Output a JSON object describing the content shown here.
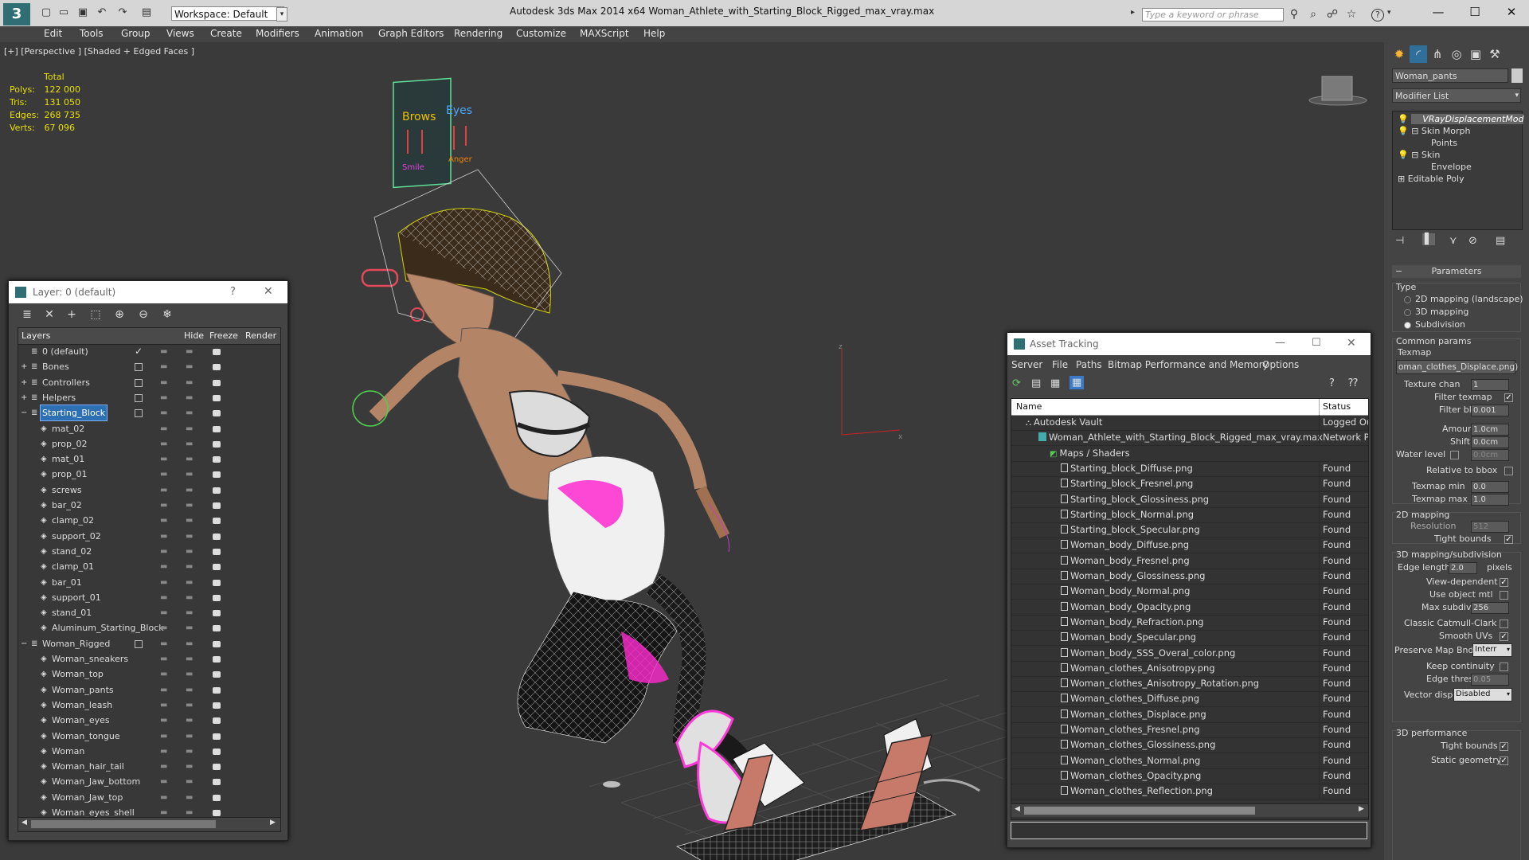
{
  "app": {
    "title": "Autodesk 3ds Max  2014 x64     Woman_Athlete_with_Starting_Block_Rigged_max_vray.max",
    "workspace": "Workspace: Default",
    "search_placeholder": "Type a keyword or phrase",
    "logo_glyph": "3"
  },
  "menu": [
    "Edit",
    "Tools",
    "Group",
    "Views",
    "Create",
    "Modifiers",
    "Animation",
    "Graph Editors",
    "Rendering",
    "Customize",
    "MAXScript",
    "Help"
  ],
  "viewport": {
    "label": "[+] [Perspective ] [Shaded + Edged Faces ]",
    "stats": {
      "header": "Total",
      "rows": [
        {
          "k": "Polys:",
          "v": "122 000"
        },
        {
          "k": "Tris:",
          "v": "131 050"
        },
        {
          "k": "Edges:",
          "v": "268 735"
        },
        {
          "k": "Verts:",
          "v": "67 096"
        }
      ]
    },
    "face_panel": {
      "brows": "Brows",
      "eyes": "Eyes",
      "smile": "Smile",
      "anger": "Anger"
    },
    "axis_z": "z",
    "axis_x": "x"
  },
  "command_panel": {
    "object_name": "Woman_pants",
    "modifier_list": "Modifier List",
    "stack": [
      {
        "label": "VRayDisplacementMod",
        "italic": true,
        "indent": 1
      },
      {
        "label": "Skin Morph",
        "indent": 1
      },
      {
        "label": "Points",
        "indent": 3
      },
      {
        "label": "Skin",
        "indent": 1
      },
      {
        "label": "Envelope",
        "indent": 3
      },
      {
        "label": "Editable Poly",
        "indent": 0
      }
    ],
    "params_title": "Parameters",
    "type_label": "Type",
    "type_options": [
      {
        "label": "2D mapping (landscape)",
        "on": false
      },
      {
        "label": "3D mapping",
        "on": false
      },
      {
        "label": "Subdivision",
        "on": true
      }
    ],
    "common_label": "Common params",
    "texmap_label": "Texmap",
    "texmap_value": "oman_clothes_Displace.png)",
    "texture_chan_label": "Texture chan",
    "texture_chan": "1",
    "filter_texmap_label": "Filter texmap",
    "filter_blur_label": "Filter blur",
    "filter_blur": "0.001",
    "amount_label": "Amount",
    "amount": "1.0cm",
    "shift_label": "Shift",
    "shift": "0.0cm",
    "water_level_label": "Water level",
    "water_level": "0.0cm",
    "relative_bbox_label": "Relative to bbox",
    "texmap_min_label": "Texmap min",
    "texmap_min": "0.0",
    "texmap_max_label": "Texmap max",
    "texmap_max": "1.0",
    "mapping2d_label": "2D mapping",
    "resolution_label": "Resolution",
    "resolution": "512",
    "tight_bounds_label": "Tight bounds",
    "mapping3d_label": "3D mapping/subdivision",
    "edge_length_label": "Edge length",
    "edge_length": "2.0",
    "pixels_label": "pixels",
    "view_dependent_label": "View-dependent",
    "use_object_mtl_label": "Use object mtl",
    "max_subdivs_label": "Max subdivs",
    "max_subdivs": "256",
    "classic_label": "Classic Catmull-Clark",
    "smooth_uvs_label": "Smooth UVs",
    "preserve_label": "Preserve Map Bnd",
    "preserve_value": "Interr",
    "keep_continuity_label": "Keep continuity",
    "edge_thresh_label": "Edge thresh",
    "edge_thresh": "0.05",
    "vector_displ_label": "Vector displ",
    "vector_displ_value": "Disabled",
    "perf_label": "3D performance",
    "perf_tight_bounds_label": "Tight bounds",
    "static_geometry_label": "Static geometry"
  },
  "layer_dialog": {
    "title": "Layer: 0 (default)",
    "help": "?",
    "close": "✕",
    "headers": {
      "layers": "Layers",
      "hide": "Hide",
      "freeze": "Freeze",
      "render": "Render"
    },
    "rows": [
      {
        "name": "0 (default)",
        "level": 0,
        "type": "layer",
        "active": true
      },
      {
        "name": "Bones",
        "level": 0,
        "type": "layer",
        "expand": "+"
      },
      {
        "name": "Controllers",
        "level": 0,
        "type": "layer",
        "expand": "+"
      },
      {
        "name": "Helpers",
        "level": 0,
        "type": "layer",
        "expand": "+"
      },
      {
        "name": "Starting_Block",
        "level": 0,
        "type": "layer",
        "expand": "−",
        "selected": true
      },
      {
        "name": "mat_02",
        "level": 1,
        "type": "obj"
      },
      {
        "name": "prop_02",
        "level": 1,
        "type": "obj"
      },
      {
        "name": "mat_01",
        "level": 1,
        "type": "obj"
      },
      {
        "name": "prop_01",
        "level": 1,
        "type": "obj"
      },
      {
        "name": "screws",
        "level": 1,
        "type": "obj"
      },
      {
        "name": "bar_02",
        "level": 1,
        "type": "obj"
      },
      {
        "name": "clamp_02",
        "level": 1,
        "type": "obj"
      },
      {
        "name": "support_02",
        "level": 1,
        "type": "obj"
      },
      {
        "name": "stand_02",
        "level": 1,
        "type": "obj"
      },
      {
        "name": "clamp_01",
        "level": 1,
        "type": "obj"
      },
      {
        "name": "bar_01",
        "level": 1,
        "type": "obj"
      },
      {
        "name": "support_01",
        "level": 1,
        "type": "obj"
      },
      {
        "name": "stand_01",
        "level": 1,
        "type": "obj"
      },
      {
        "name": "Aluminum_Starting_Block",
        "level": 1,
        "type": "obj"
      },
      {
        "name": "Woman_Rigged",
        "level": 0,
        "type": "layer",
        "expand": "−"
      },
      {
        "name": "Woman_sneakers",
        "level": 1,
        "type": "obj"
      },
      {
        "name": "Woman_top",
        "level": 1,
        "type": "obj"
      },
      {
        "name": "Woman_pants",
        "level": 1,
        "type": "obj"
      },
      {
        "name": "Woman_leash",
        "level": 1,
        "type": "obj"
      },
      {
        "name": "Woman_eyes",
        "level": 1,
        "type": "obj"
      },
      {
        "name": "Woman_tongue",
        "level": 1,
        "type": "obj"
      },
      {
        "name": "Woman",
        "level": 1,
        "type": "obj"
      },
      {
        "name": "Woman_hair_tail",
        "level": 1,
        "type": "obj"
      },
      {
        "name": "Woman_Jaw_bottom",
        "level": 1,
        "type": "obj"
      },
      {
        "name": "Woman_Jaw_top",
        "level": 1,
        "type": "obj"
      },
      {
        "name": "Woman_eyes_shell",
        "level": 1,
        "type": "obj"
      }
    ]
  },
  "asset_dialog": {
    "title": "Asset Tracking",
    "menu": [
      "Server",
      "File",
      "Paths",
      "Bitmap Performance and Memory",
      "Options"
    ],
    "headers": {
      "name": "Name",
      "status": "Status"
    },
    "rows": [
      {
        "name": "Autodesk Vault",
        "status": "Logged Ou",
        "level": 0,
        "icon": "vault"
      },
      {
        "name": "Woman_Athlete_with_Starting_Block_Rigged_max_vray.max",
        "status": "Network P",
        "level": 1,
        "icon": "max"
      },
      {
        "name": "Maps / Shaders",
        "status": "",
        "level": 2,
        "icon": "maps"
      },
      {
        "name": "Starting_block_Diffuse.png",
        "status": "Found",
        "level": 3,
        "icon": "file"
      },
      {
        "name": "Starting_block_Fresnel.png",
        "status": "Found",
        "level": 3,
        "icon": "file"
      },
      {
        "name": "Starting_block_Glossiness.png",
        "status": "Found",
        "level": 3,
        "icon": "file"
      },
      {
        "name": "Starting_block_Normal.png",
        "status": "Found",
        "level": 3,
        "icon": "file"
      },
      {
        "name": "Starting_block_Specular.png",
        "status": "Found",
        "level": 3,
        "icon": "file"
      },
      {
        "name": "Woman_body_Diffuse.png",
        "status": "Found",
        "level": 3,
        "icon": "file"
      },
      {
        "name": "Woman_body_Fresnel.png",
        "status": "Found",
        "level": 3,
        "icon": "file"
      },
      {
        "name": "Woman_body_Glossiness.png",
        "status": "Found",
        "level": 3,
        "icon": "file"
      },
      {
        "name": "Woman_body_Normal.png",
        "status": "Found",
        "level": 3,
        "icon": "file"
      },
      {
        "name": "Woman_body_Opacity.png",
        "status": "Found",
        "level": 3,
        "icon": "file"
      },
      {
        "name": "Woman_body_Refraction.png",
        "status": "Found",
        "level": 3,
        "icon": "file"
      },
      {
        "name": "Woman_body_Specular.png",
        "status": "Found",
        "level": 3,
        "icon": "file"
      },
      {
        "name": "Woman_body_SSS_Overal_color.png",
        "status": "Found",
        "level": 3,
        "icon": "file"
      },
      {
        "name": "Woman_clothes_Anisotropy.png",
        "status": "Found",
        "level": 3,
        "icon": "file"
      },
      {
        "name": "Woman_clothes_Anisotropy_Rotation.png",
        "status": "Found",
        "level": 3,
        "icon": "file"
      },
      {
        "name": "Woman_clothes_Diffuse.png",
        "status": "Found",
        "level": 3,
        "icon": "file"
      },
      {
        "name": "Woman_clothes_Displace.png",
        "status": "Found",
        "level": 3,
        "icon": "file"
      },
      {
        "name": "Woman_clothes_Fresnel.png",
        "status": "Found",
        "level": 3,
        "icon": "file"
      },
      {
        "name": "Woman_clothes_Glossiness.png",
        "status": "Found",
        "level": 3,
        "icon": "file"
      },
      {
        "name": "Woman_clothes_Normal.png",
        "status": "Found",
        "level": 3,
        "icon": "file"
      },
      {
        "name": "Woman_clothes_Opacity.png",
        "status": "Found",
        "level": 3,
        "icon": "file"
      },
      {
        "name": "Woman_clothes_Reflection.png",
        "status": "Found",
        "level": 3,
        "icon": "file"
      }
    ]
  },
  "colors": {
    "selection": "#2d6fb3",
    "stats_yellow": "#e8e000",
    "accent_teal": "#2f6f73"
  }
}
